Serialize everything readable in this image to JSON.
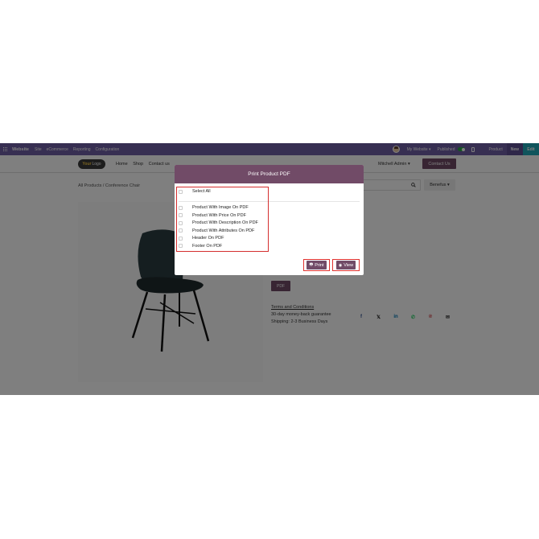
{
  "topbar": {
    "brand": "Website",
    "menu": [
      "Site",
      "eCommerce",
      "Reporting",
      "Configuration"
    ],
    "website_selector": "My Website ▾",
    "published_label": "Published",
    "product_label": "Product",
    "new_label": "New",
    "edit_label": "Edit"
  },
  "header": {
    "logo_text_1": "Your",
    "logo_text_2": "Logo",
    "nav": [
      "Home",
      "Shop",
      "Contact us"
    ],
    "user_label": "Mitchell Admin ▾",
    "contact_button": "Contact Us"
  },
  "page": {
    "breadcrumb": "All Products  /  Conference Chair",
    "sort_label": "Benefus ▾",
    "pdf_button": "PDF",
    "terms_link": "Terms and Conditions",
    "guarantee": "30-day money-back guarantee",
    "shipping": "Shipping: 2-3 Business Days",
    "socials": [
      {
        "icon": "facebook-icon",
        "glyph": "f",
        "color": "#3b5998"
      },
      {
        "icon": "x-twitter-icon",
        "glyph": "𝕏",
        "color": "#111111"
      },
      {
        "icon": "linkedin-icon",
        "glyph": "in",
        "color": "#0077b5"
      },
      {
        "icon": "whatsapp-icon",
        "glyph": "✆",
        "color": "#25d366"
      },
      {
        "icon": "pinterest-icon",
        "glyph": "℗",
        "color": "#cb2027"
      },
      {
        "icon": "envelope-icon",
        "glyph": "✉",
        "color": "#333333"
      }
    ]
  },
  "modal": {
    "title": "Print Product PDF",
    "select_all": "Select All",
    "options": [
      "Product With Image On PDF",
      "Product With Price On PDF",
      "Product With Description On PDF",
      "Product With Attributes On PDF",
      "Header On PDF",
      "Footer On PDF"
    ],
    "print_label": "Print",
    "view_label": "View"
  },
  "colors": {
    "admin_bar": "#6f5ea4",
    "brand_primary": "#714b67",
    "highlight": "#d42e2e",
    "edit_button": "#21a8b8"
  }
}
